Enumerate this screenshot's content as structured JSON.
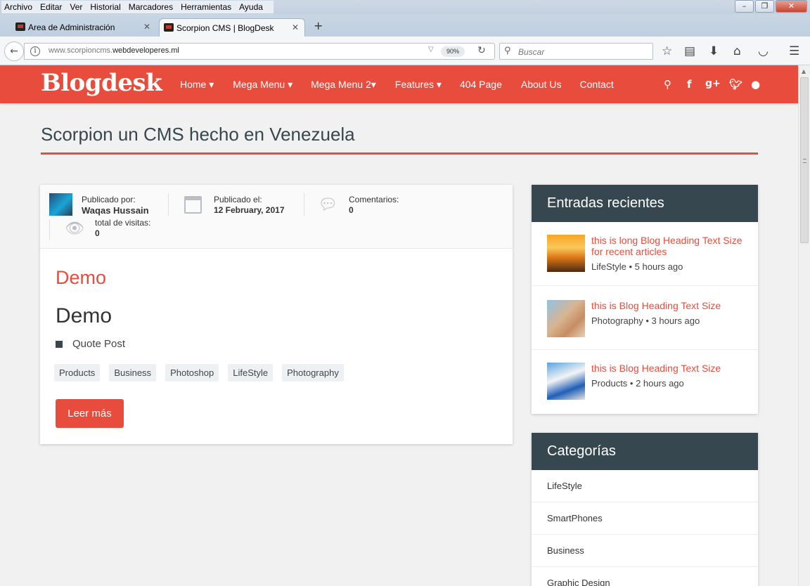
{
  "browser": {
    "menu": [
      "Archivo",
      "Editar",
      "Ver",
      "Historial",
      "Marcadores",
      "Herramientas",
      "Ayuda"
    ],
    "tabs": [
      {
        "label": "Area de Administración"
      },
      {
        "label": "Scorpion CMS | BlogDesk"
      }
    ],
    "url_prefix": "www.scorpioncms.",
    "url_domain": "webdeveloperes.ml",
    "zoom": "90%",
    "search_placeholder": "Buscar"
  },
  "site": {
    "logo": "Blogdesk",
    "nav": [
      "Home ▾",
      "Mega Menu ▾",
      "Mega Menu 2▾",
      "Features ▾",
      "404 Page",
      "About Us",
      "Contact"
    ],
    "accent": "#e74c3c",
    "dark": "#37474f"
  },
  "page": {
    "title": "Scorpion un CMS hecho en Venezuela"
  },
  "post": {
    "author_label": "Publicado por:",
    "author": "Waqas Hussain",
    "date_label": "Publicado el:",
    "date": "12 February, 2017",
    "comments_label": "Comentarios:",
    "comments": "0",
    "visits_label": "total de visitas:",
    "visits": "0",
    "category": "Demo",
    "heading": "Demo",
    "quote": "Quote Post",
    "tags": [
      "Products",
      "Business",
      "Photoshop",
      "LifeStyle",
      "Photography"
    ],
    "read_more": "Leer más"
  },
  "recent": {
    "heading": "Entradas recientes",
    "items": [
      {
        "title": "this is long Blog Heading Text Size for recent articles",
        "category": "LifeStyle",
        "time": "5 hours ago"
      },
      {
        "title": "this is Blog Heading Text Size",
        "category": "Photography",
        "time": "3 hours ago"
      },
      {
        "title": "this is Blog Heading Text Size",
        "category": "Products",
        "time": "2 hours ago"
      }
    ]
  },
  "categories": {
    "heading": "Categorías",
    "items": [
      "LifeStyle",
      "SmartPhones",
      "Business",
      "Graphic Design"
    ]
  }
}
